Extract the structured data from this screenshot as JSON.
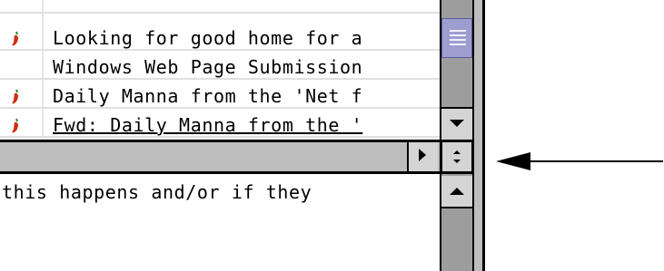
{
  "message_list": {
    "rows": [
      {
        "subject": "Looking for good home for a",
        "has_pepper_icon": true
      },
      {
        "subject": "Windows Web Page Submission",
        "has_pepper_icon": false
      },
      {
        "subject": "Daily Manna from the 'Net f",
        "has_pepper_icon": true
      },
      {
        "subject": "Fwd: Daily Manna from the '",
        "has_pepper_icon": true
      }
    ]
  },
  "message_body": {
    "text": "this happens and/or if they"
  },
  "icons": {
    "row_icon": "chili-pepper-icon",
    "scroll_up": "up-triangle-icon",
    "scroll_down": "down-triangle-icon",
    "splitter": "splitter-arrows-icon",
    "expand": "right-triangle-icon",
    "annotation": "left-pointing-arrow"
  },
  "colors": {
    "pepper_red": "#d22b10",
    "pepper_stem": "#2e8b2e",
    "scroll_thumb": "#9d9dcf",
    "scroll_track": "#9d9d9d"
  }
}
